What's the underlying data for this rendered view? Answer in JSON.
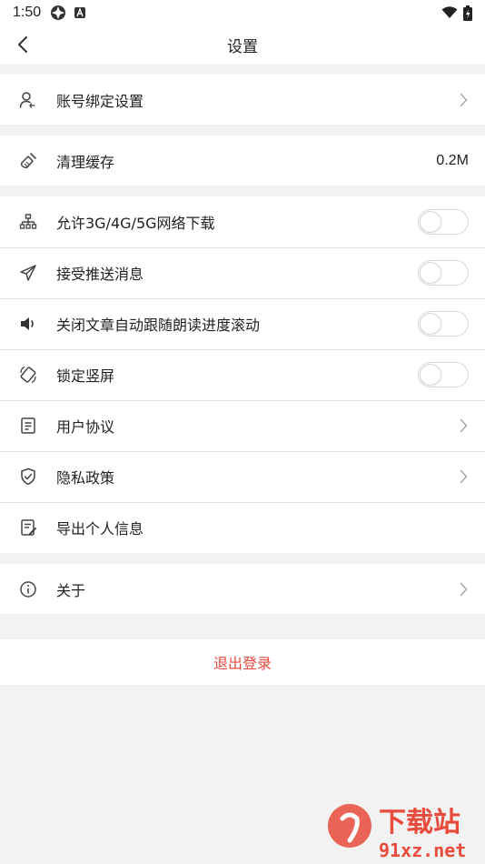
{
  "status": {
    "time": "1:50"
  },
  "nav": {
    "title": "设置"
  },
  "account": {
    "label": "账号绑定设置"
  },
  "cache": {
    "label": "清理缓存",
    "value": "0.2M"
  },
  "toggles": [
    {
      "label": "允许3G/4G/5G网络下载",
      "on": false
    },
    {
      "label": "接受推送消息",
      "on": false
    },
    {
      "label": "关闭文章自动跟随朗读进度滚动",
      "on": false
    },
    {
      "label": "锁定竖屏",
      "on": false
    }
  ],
  "links": [
    {
      "label": "用户协议"
    },
    {
      "label": "隐私政策"
    },
    {
      "label": "导出个人信息"
    }
  ],
  "about": {
    "label": "关于"
  },
  "logout": {
    "label": "退出登录",
    "color": "#e8483c"
  },
  "watermark": {
    "brand": "下载站",
    "site": "91xz.net"
  }
}
